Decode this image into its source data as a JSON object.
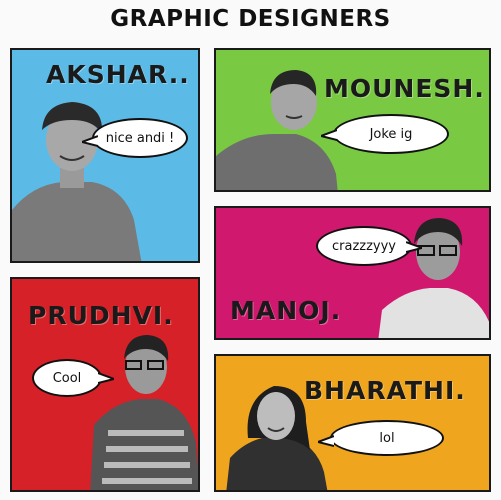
{
  "title": "GRAPHIC DESIGNERS",
  "colors": {
    "blue": "#5bbbe6",
    "green": "#79c943",
    "magenta": "#d0186f",
    "red": "#d62128",
    "orange": "#efa51d"
  },
  "cards": [
    {
      "name": "AKSHAR..",
      "quote": "nice andi !"
    },
    {
      "name": "MOUNESH.",
      "quote": "Joke ig"
    },
    {
      "name": "MANOJ.",
      "quote": "crazzzyyy"
    },
    {
      "name": "PRUDHVI.",
      "quote": "Cool"
    },
    {
      "name": "BHARATHI.",
      "quote": "lol"
    }
  ]
}
